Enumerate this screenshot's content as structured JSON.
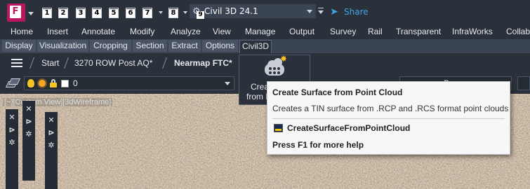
{
  "quick_access": {
    "app_letter": "F",
    "key_tips": [
      "1",
      "2",
      "3",
      "4",
      "5",
      "6",
      "7",
      "8",
      "9"
    ],
    "workspace": "Civil 3D 24.1",
    "share_label": "Share"
  },
  "ribbon": {
    "tabs": [
      "Home",
      "Insert",
      "Annotate",
      "Modify",
      "Analyze",
      "View",
      "Manage",
      "Output",
      "Survey",
      "Rail",
      "Transparent",
      "InfraWorks",
      "Collab"
    ]
  },
  "panels": {
    "items": [
      "Display",
      "Visualization",
      "Cropping",
      "Section",
      "Extract",
      "Options",
      "Civil3D"
    ],
    "active": "Civil3D"
  },
  "doc_tabs": {
    "items": [
      "Start",
      "3270 ROW Post AQ*",
      "Nearmap FTC*"
    ],
    "active": "Nearmap FTC*"
  },
  "properties": {
    "layer_name": "0",
    "bylayer_text": "By"
  },
  "viewport": {
    "label": "[−][Custom View][3dWireframe]"
  },
  "flyout": {
    "label_line1": "Crea",
    "label_line2": "from P"
  },
  "tooltip": {
    "title": "Create Surface from Point Cloud",
    "description": "Creates a TIN surface from .RCP and .RCS format point clouds",
    "command": "CreateSurfaceFromPointCloud",
    "help": "Press F1 for more help"
  },
  "colors": {
    "background": "#2b313b",
    "panel_strip": "#3b4453",
    "brand": "#b8165e",
    "share": "#3ea4e6"
  }
}
